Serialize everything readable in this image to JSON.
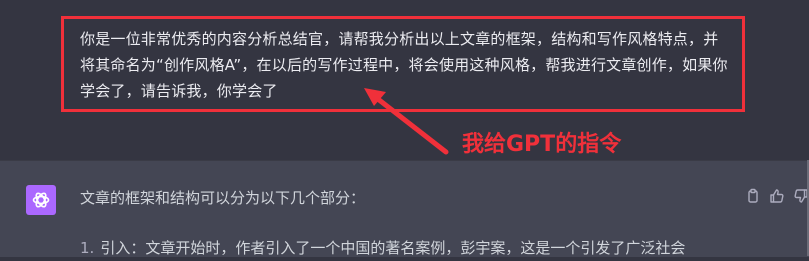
{
  "user_message": {
    "text": "你是一位非常优秀的内容分析总结官，请帮我分析出以上文章的框架，结构和写作风格特点，并将其命名为“创作风格A”，在以后的写作过程中，将会使用这种风格，帮我进行文章创作，如果你学会了，请告诉我，你学会了"
  },
  "annotation": {
    "label": "我给GPT的指令",
    "color": "#f0303a"
  },
  "assistant_message": {
    "intro": "文章的框架和结构可以分为以下几个部分：",
    "list_items": [
      {
        "number": "1.",
        "text": "引入：文章开始时，作者引入了一个中国的著名案例，彭宇案，这是一个引发了广泛社会"
      }
    ],
    "avatar_icon": "openai-logo-icon",
    "avatar_color": "#ab68ff"
  },
  "actions": [
    {
      "name": "copy-icon"
    },
    {
      "name": "thumbs-up-icon"
    },
    {
      "name": "thumbs-down-icon"
    }
  ]
}
